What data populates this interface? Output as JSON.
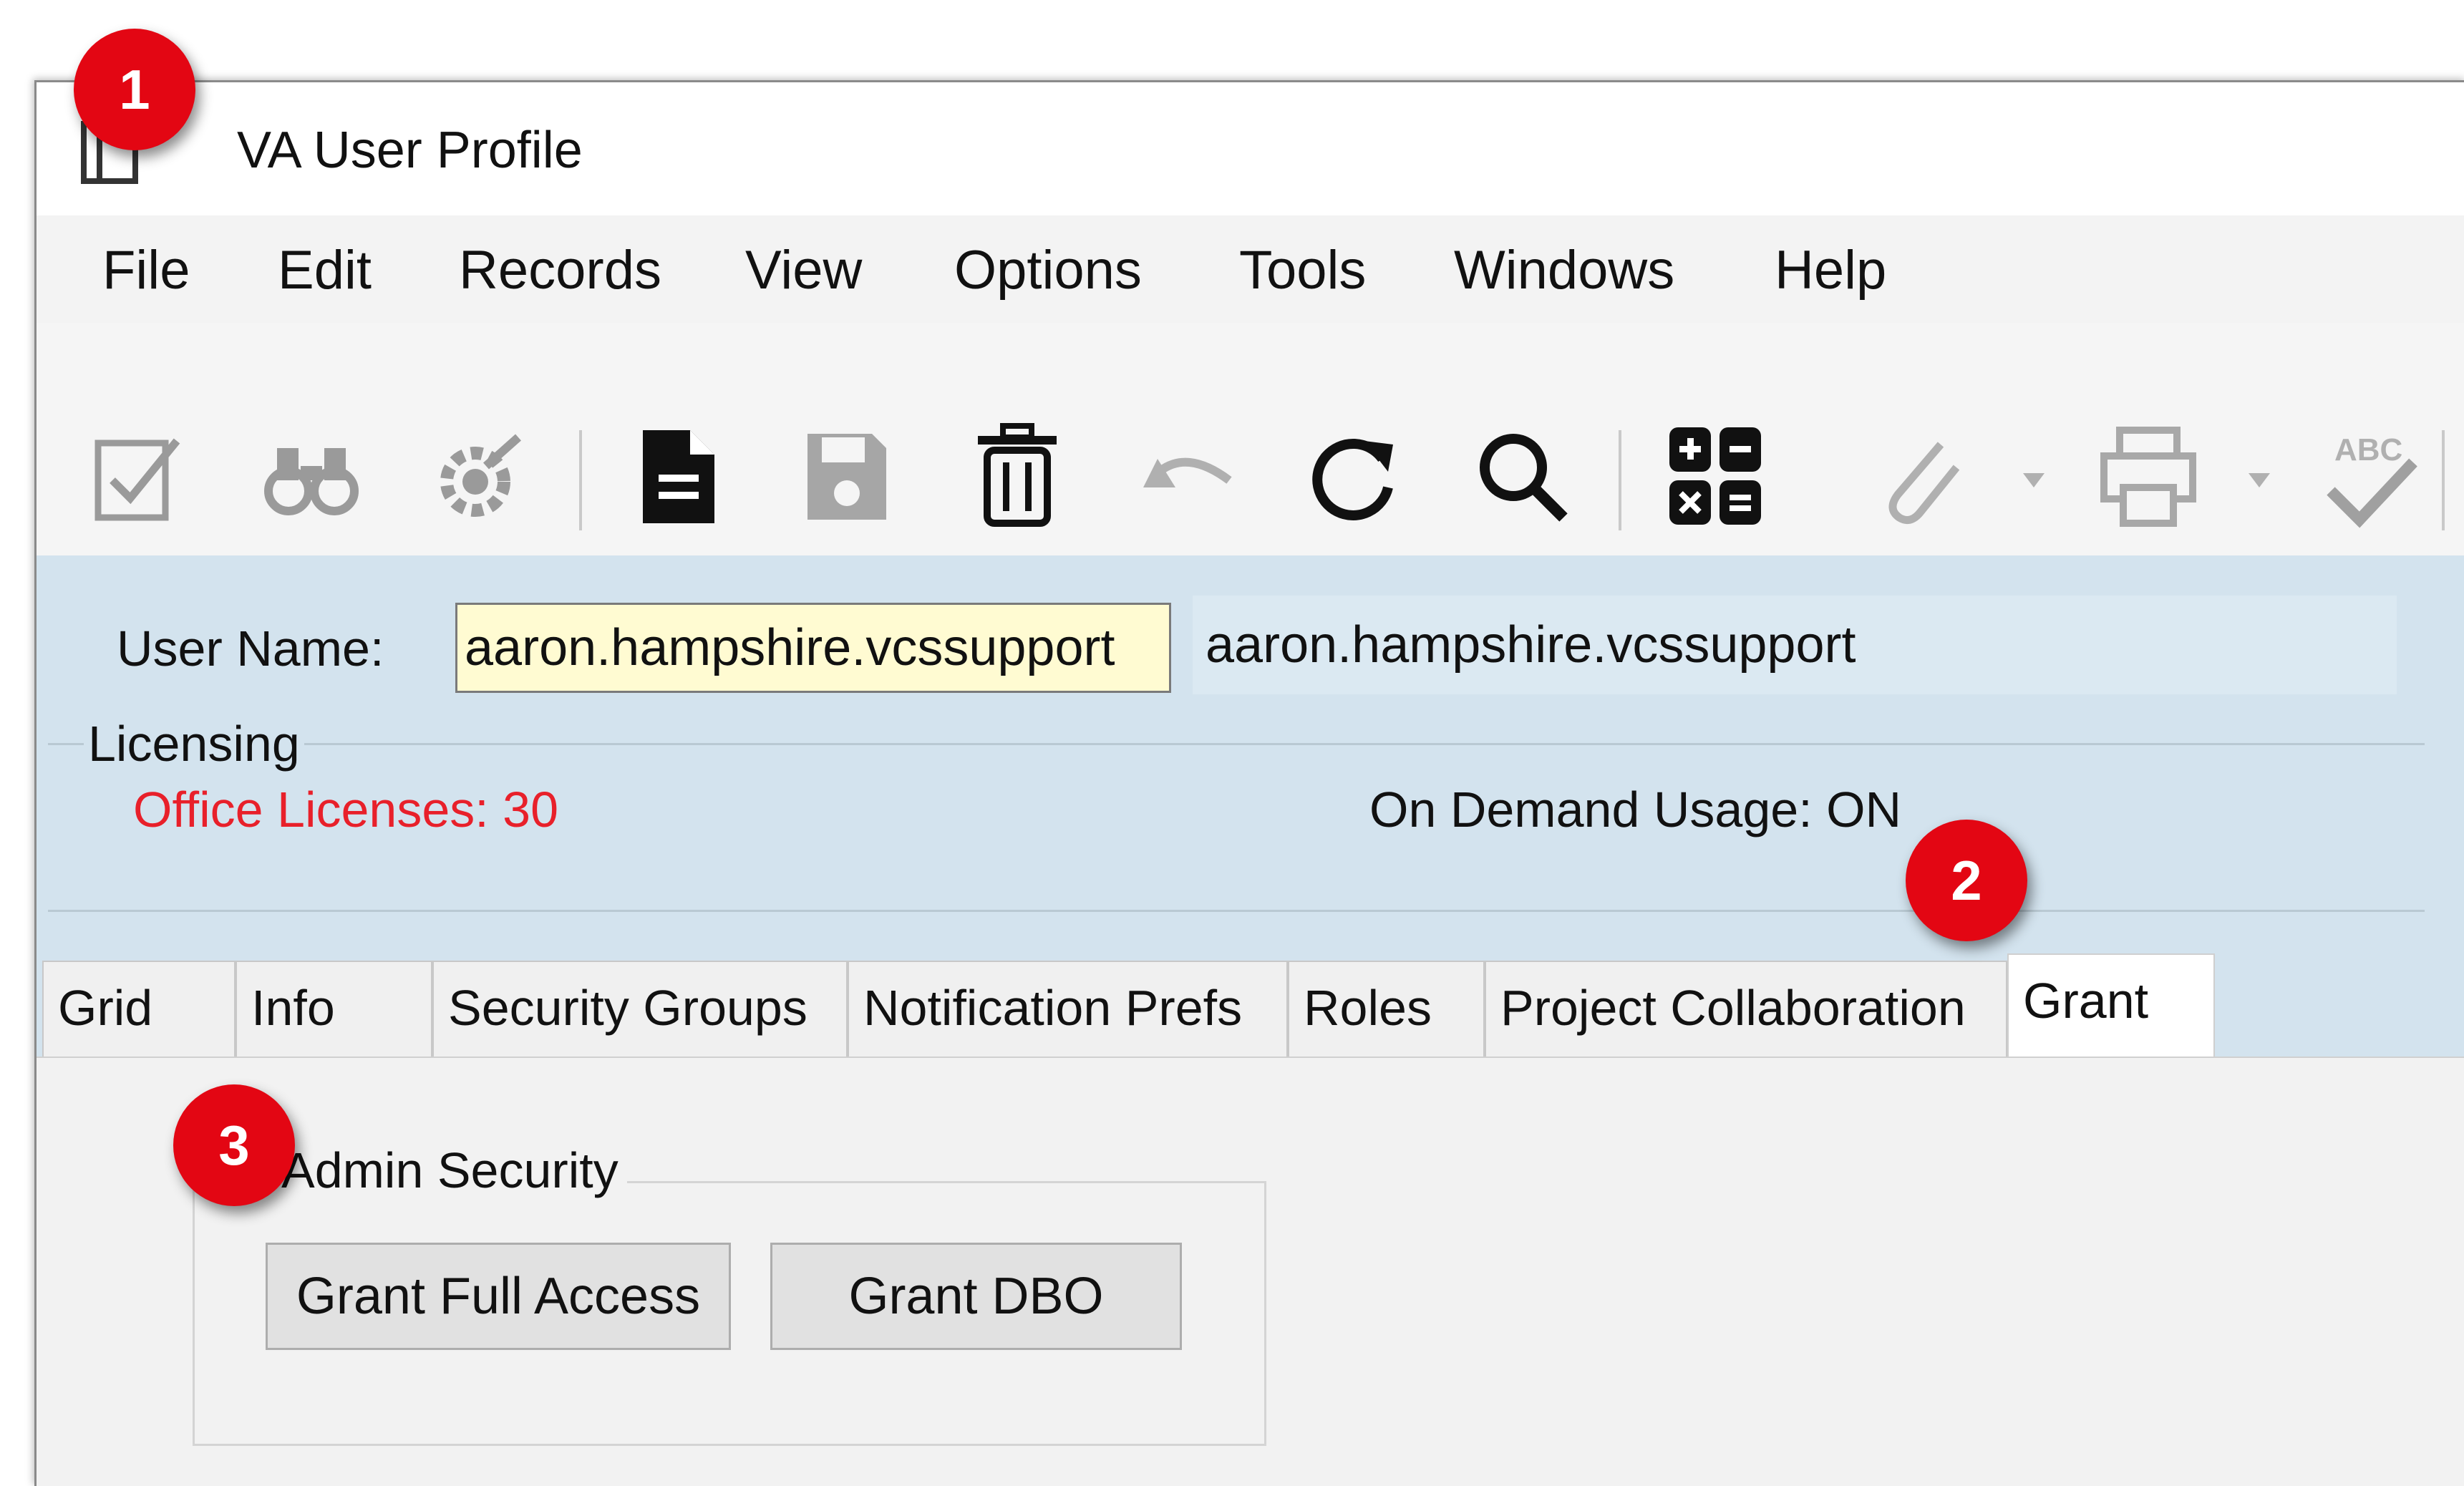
{
  "window": {
    "title": "VA User Profile"
  },
  "menu": [
    "File",
    "Edit",
    "Records",
    "View",
    "Options",
    "Tools",
    "Windows",
    "Help"
  ],
  "toolbar": {
    "buttons": [
      "edit-check-icon",
      "binoculars-icon",
      "settings-gear-icon",
      "new-document-icon",
      "save-icon",
      "delete-trash-icon",
      "undo-icon",
      "refresh-icon",
      "search-icon",
      "calculator-icon",
      "attachment-icon",
      "print-icon",
      "spellcheck-icon"
    ],
    "spellcheck_text": "ABC"
  },
  "header": {
    "username_label": "User Name:",
    "username_value": "aaron.hampshire.vcssupport",
    "username_display": "aaron.hampshire.vcssupport",
    "licensing_label": "Licensing",
    "office_licenses": "Office Licenses: 30",
    "on_demand": "On Demand Usage: ON"
  },
  "tabs": [
    "Grid",
    "Info",
    "Security Groups",
    "Notification Prefs",
    "Roles",
    "Project Collaboration",
    "Grant"
  ],
  "active_tab": "Grant",
  "admin_security": {
    "title": "Admin Security",
    "grant_full_access": "Grant Full Access",
    "grant_dbo": "Grant DBO"
  },
  "badges": [
    "1",
    "2",
    "3"
  ],
  "colors": {
    "badge": "#e30613",
    "license_text": "#e8202a",
    "header_bg": "#d3e3ee",
    "input_bg": "#fffbd2"
  }
}
